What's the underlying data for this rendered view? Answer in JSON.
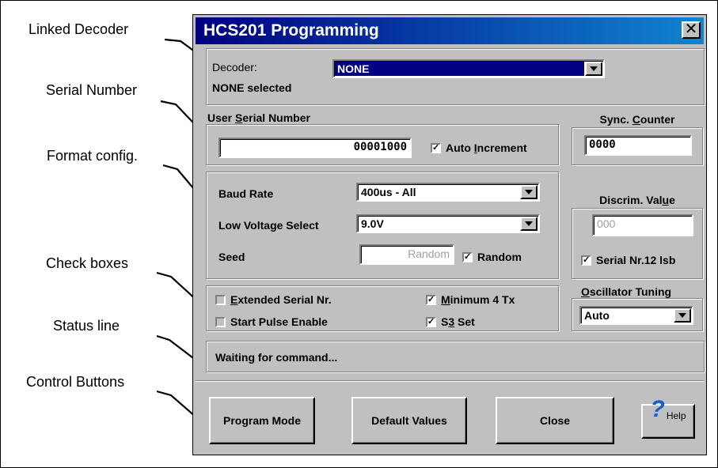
{
  "callouts": {
    "linked_decoder": "Linked Decoder",
    "serial_number": "Serial Number",
    "format_config": "Format config.",
    "check_boxes": "Check boxes",
    "status_line": "Status line",
    "control_buttons": "Control Buttons"
  },
  "dialog": {
    "title": "HCS201 Programming",
    "close_glyph": "✕"
  },
  "decoder": {
    "label": "Decoder:",
    "selected": "NONE",
    "status": "NONE selected"
  },
  "serial": {
    "label_prefix": "User ",
    "label_accel": "S",
    "label_suffix": "erial Number",
    "value": "00001000",
    "auto_increment_prefix": "Auto ",
    "auto_increment_accel": "I",
    "auto_increment_suffix": "ncrement",
    "auto_increment_checked": true
  },
  "sync": {
    "label_prefix": "Sync. ",
    "label_accel": "C",
    "label_suffix": "ounter",
    "value": "0000"
  },
  "format": {
    "baud_label": "Baud Rate",
    "baud_value": "400us - All",
    "lowvolt_label": "Low Voltage Select",
    "lowvolt_value": "9.0V",
    "seed_label": "Seed",
    "seed_value": "Random",
    "random_label": "Random",
    "random_checked": true
  },
  "discrim": {
    "label_prefix": "Discrim. Val",
    "label_accel": "u",
    "label_suffix": "e",
    "value": "000",
    "serial12_label": "Serial Nr.12 lsb",
    "serial12_checked": true
  },
  "options": {
    "extended_accel": "E",
    "extended_rest": "xtended Serial Nr.",
    "extended_checked": false,
    "start_pulse_label": "Start Pulse Enable",
    "start_pulse_checked": false,
    "min4tx_accel": "M",
    "min4tx_rest": "inimum 4 Tx",
    "min4tx_checked": true,
    "s3_prefix": "S",
    "s3_accel": "3",
    "s3_suffix": " Set",
    "s3_checked": true
  },
  "oscillator": {
    "label_accel": "O",
    "label_rest": "scillator Tuning",
    "value": "Auto"
  },
  "status": {
    "text": "Waiting for command..."
  },
  "buttons": {
    "program_mode": "Program Mode",
    "default_values": "Default Values",
    "close": "Close",
    "help": "Help",
    "help_glyph": "?"
  },
  "colors": {
    "title_start": "#000080",
    "title_end": "#1084d0",
    "face": "#c0c0c0",
    "decoder_highlight": "#000080"
  }
}
